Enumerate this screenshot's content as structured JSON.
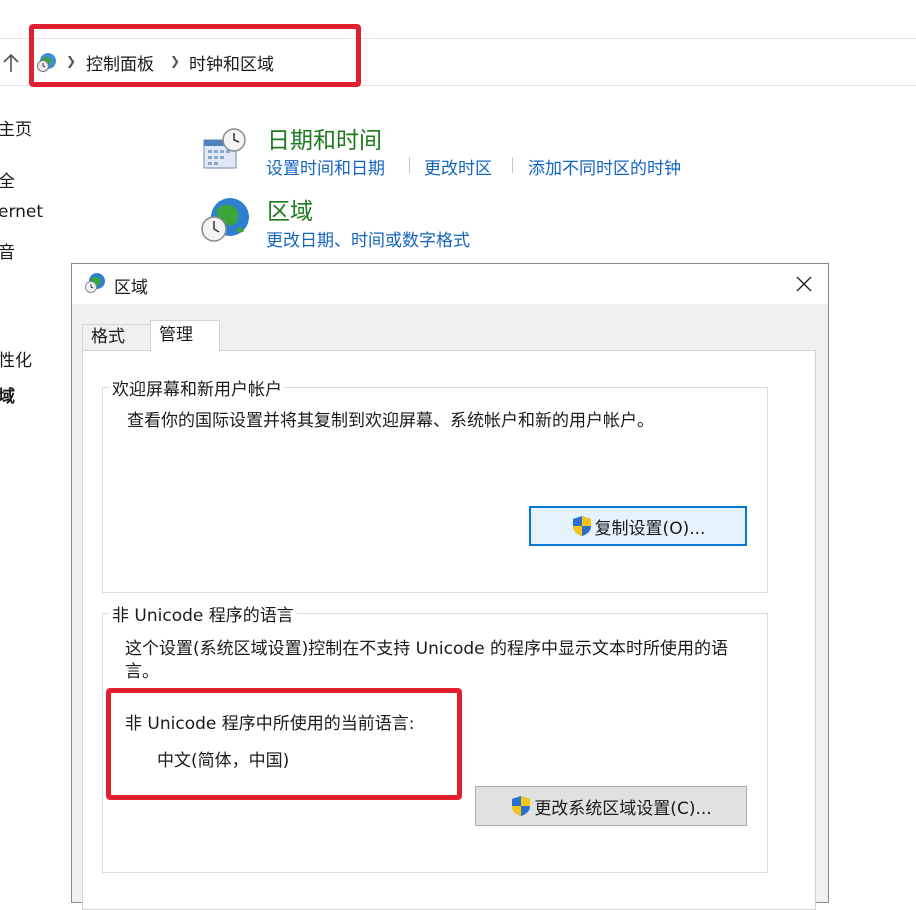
{
  "breadcrumb": {
    "items": [
      "控制面板",
      "时钟和区域"
    ]
  },
  "sidebar": {
    "items": [
      {
        "label": "主页",
        "bold": false
      },
      {
        "label": "全",
        "bold": false
      },
      {
        "label": "ernet",
        "bold": false
      },
      {
        "label": "音",
        "bold": false
      },
      {
        "label": "性化",
        "bold": false
      },
      {
        "label": "域",
        "bold": true
      }
    ]
  },
  "categories": {
    "datetime": {
      "title": "日期和时间",
      "links": [
        "设置时间和日期",
        "更改时区",
        "添加不同时区的时钟"
      ]
    },
    "region": {
      "title": "区域",
      "links": [
        "更改日期、时间或数字格式"
      ]
    }
  },
  "dialog": {
    "title": "区域",
    "tabs": [
      "格式",
      "管理"
    ],
    "active_tab": "管理",
    "welcome_group": {
      "legend": "欢迎屏幕和新用户帐户",
      "description": "查看你的国际设置并将其复制到欢迎屏幕、系统帐户和新的用户帐户。",
      "button_label": "复制设置(O)..."
    },
    "unicode_group": {
      "legend": "非 Unicode 程序的语言",
      "description": "这个设置(系统区域设置)控制在不支持 Unicode 的程序中显示文本时所使用的语言。",
      "current_label": "非 Unicode 程序中所使用的当前语言:",
      "current_value": "中文(简体，中国)",
      "button_label": "更改系统区域设置(C)..."
    }
  },
  "colors": {
    "category_title": "#1e7a1e",
    "link": "#1565c0",
    "annotation": "#e02030",
    "focus_border": "#0078d7"
  }
}
